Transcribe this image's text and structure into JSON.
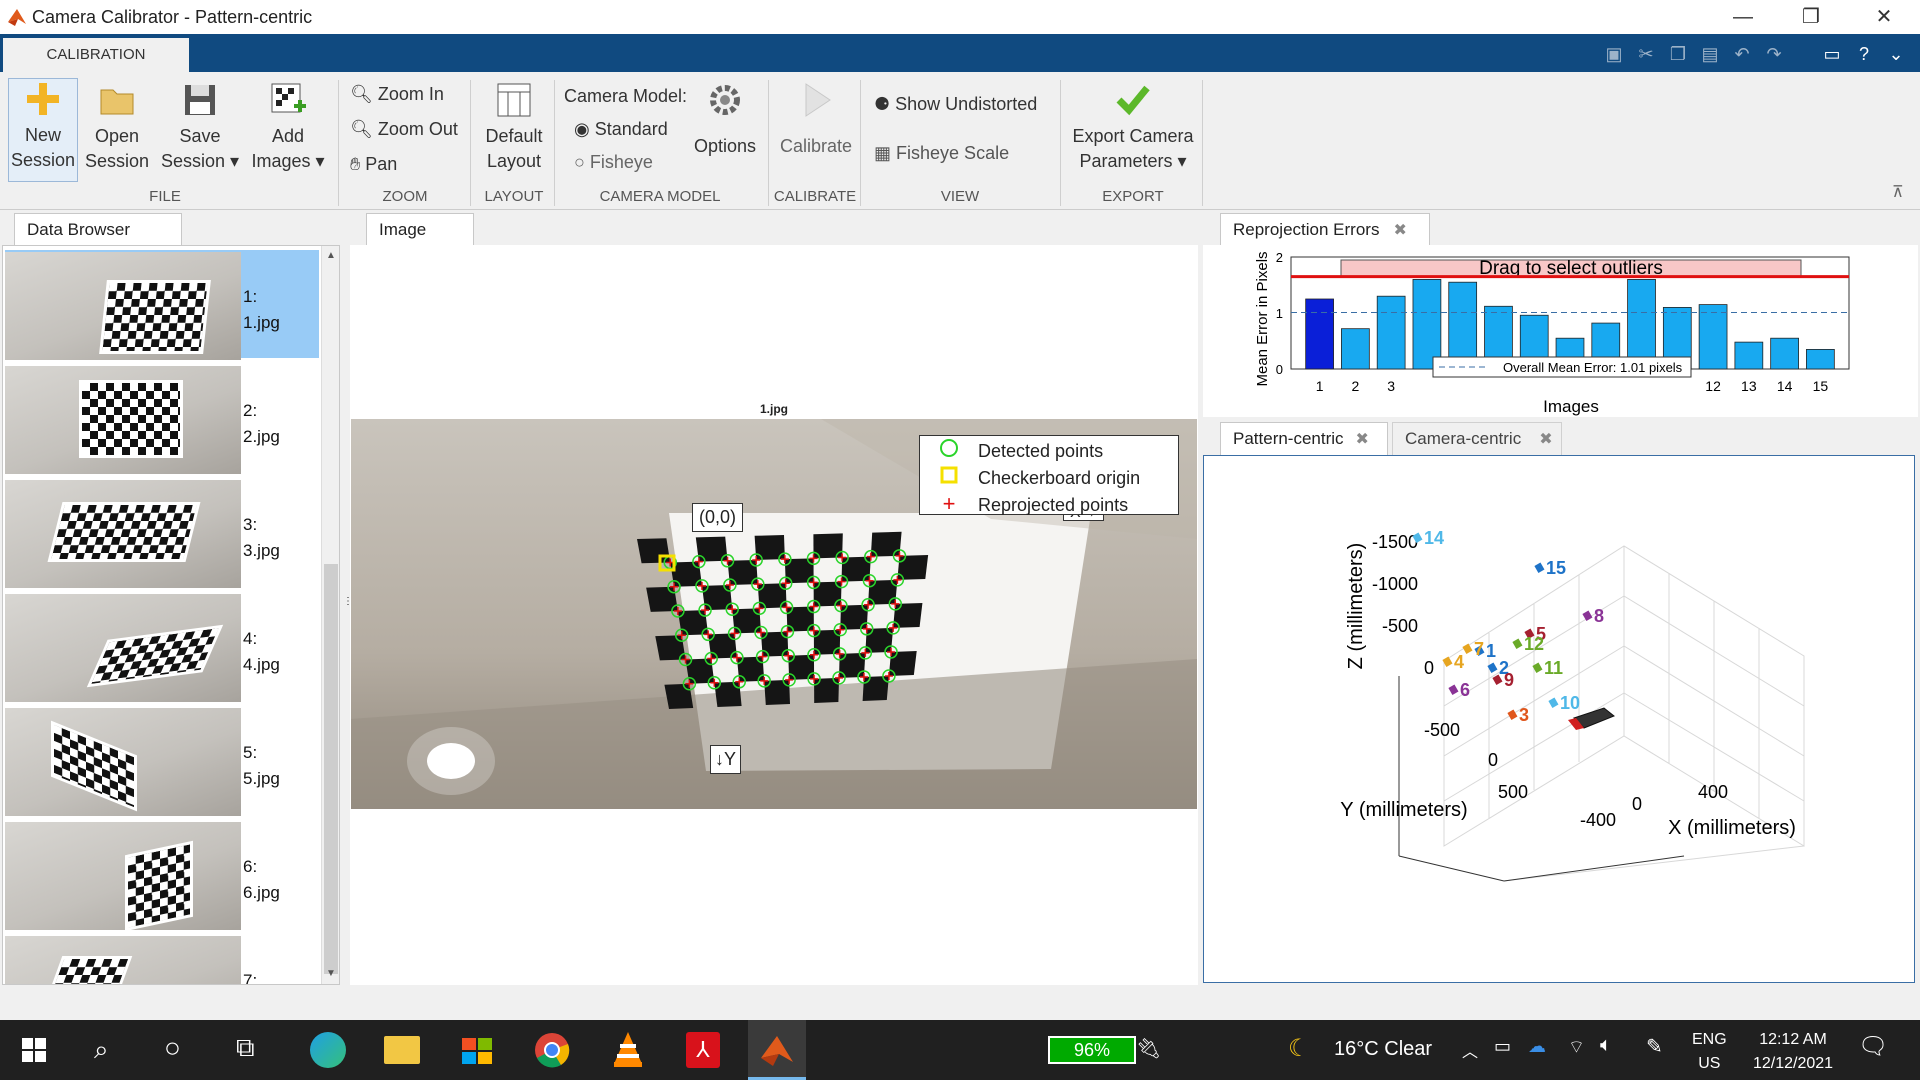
{
  "window": {
    "title": "Camera Calibrator - Pattern-centric",
    "min": "—",
    "max": "❐",
    "close": "✕"
  },
  "ribbon_tab": "CALIBRATION",
  "ribbon": {
    "file": {
      "group": "FILE",
      "new": [
        "New",
        "Session"
      ],
      "open": [
        "Open",
        "Session"
      ],
      "save": [
        "Save",
        "Session ▾"
      ],
      "add": [
        "Add",
        "Images ▾"
      ]
    },
    "zoom": {
      "group": "ZOOM",
      "zoom_in": "Zoom In",
      "zoom_out": "Zoom Out",
      "pan": "Pan"
    },
    "layout": {
      "group": "LAYOUT",
      "default": [
        "Default",
        "Layout"
      ]
    },
    "camera_model": {
      "group": "CAMERA MODEL",
      "label": "Camera Model:",
      "standard": "Standard",
      "fisheye": "Fisheye",
      "options": "Options"
    },
    "calibrate": {
      "group": "CALIBRATE",
      "button": "Calibrate"
    },
    "view": {
      "group": "VIEW",
      "show_undistorted": "Show Undistorted",
      "fisheye_scale": "Fisheye Scale"
    },
    "export": {
      "group": "EXPORT",
      "button": [
        "Export Camera",
        "Parameters ▾"
      ]
    }
  },
  "data_browser": {
    "title": "Data Browser",
    "items": [
      {
        "num": "1:",
        "file": "1.jpg",
        "selected": true
      },
      {
        "num": "2:",
        "file": "2.jpg"
      },
      {
        "num": "3:",
        "file": "3.jpg"
      },
      {
        "num": "4:",
        "file": "4.jpg"
      },
      {
        "num": "5:",
        "file": "5.jpg"
      },
      {
        "num": "6:",
        "file": "6.jpg"
      },
      {
        "num": "7:",
        "file": ""
      }
    ]
  },
  "image_panel": {
    "title": "Image",
    "filename": "1.jpg",
    "origin_label": "(0,0)",
    "x_label": "X→",
    "y_label": "↓Y",
    "legend": [
      "Detected points",
      "Checkerboard origin",
      "Reprojected points"
    ]
  },
  "reprojection": {
    "title": "Reprojection Errors",
    "ylabel": "Mean Error in Pixels",
    "xlabel": "Images",
    "banner": "Drag to select outliers",
    "mean_label": "Overall Mean Error: 1.01 pixels",
    "yticks": [
      "0",
      "1",
      "2"
    ],
    "xticks": [
      "1",
      "2",
      "3",
      "12",
      "13",
      "14",
      "15"
    ]
  },
  "chart_data": {
    "type": "bar",
    "categories": [
      "1",
      "2",
      "3",
      "4",
      "5",
      "6",
      "7",
      "8",
      "9",
      "10",
      "11",
      "12",
      "13",
      "14",
      "15"
    ],
    "values": [
      1.25,
      0.72,
      1.3,
      1.6,
      1.55,
      1.12,
      0.96,
      0.55,
      0.82,
      1.6,
      1.1,
      1.15,
      0.48,
      0.55,
      0.35
    ],
    "ylim": [
      0,
      2
    ],
    "ylabel": "Mean Error in Pixels",
    "xlabel": "Images",
    "threshold": 1.65,
    "overall_mean": 1.01,
    "selected_index": 0,
    "colors": {
      "bar": "#18a9f0",
      "selected": "#0a1fd8",
      "threshold": "#e01010"
    }
  },
  "view_tabs": {
    "pattern": "Pattern-centric",
    "camera": "Camera-centric"
  },
  "view3d": {
    "zlabel": "Z (millimeters)",
    "ylabel": "Y (millimeters)",
    "xlabel": "X (millimeters)",
    "zticks": [
      "-1500",
      "-1000",
      "-500",
      "0"
    ],
    "yticks": [
      "-500",
      "0",
      "500"
    ],
    "xticks": [
      "-400",
      "0",
      "400"
    ],
    "cameras": [
      {
        "id": "1",
        "color": "#1e73c8"
      },
      {
        "id": "2",
        "color": "#1e73c8"
      },
      {
        "id": "3",
        "color": "#e0561c"
      },
      {
        "id": "4",
        "color": "#e6a520"
      },
      {
        "id": "5",
        "color": "#a52030"
      },
      {
        "id": "6",
        "color": "#8a3396"
      },
      {
        "id": "7",
        "color": "#e6a520"
      },
      {
        "id": "8",
        "color": "#8a3396"
      },
      {
        "id": "9",
        "color": "#a52030"
      },
      {
        "id": "10",
        "color": "#4fb8e8"
      },
      {
        "id": "11",
        "color": "#6aaa28"
      },
      {
        "id": "12",
        "color": "#6aaa28"
      },
      {
        "id": "14",
        "color": "#4fb8e8"
      },
      {
        "id": "15",
        "color": "#1e73c8"
      }
    ]
  },
  "taskbar": {
    "battery": "96%",
    "weather": "16°C  Clear",
    "lang": [
      "ENG",
      "US"
    ],
    "time": "12:12 AM",
    "date": "12/12/2021"
  }
}
